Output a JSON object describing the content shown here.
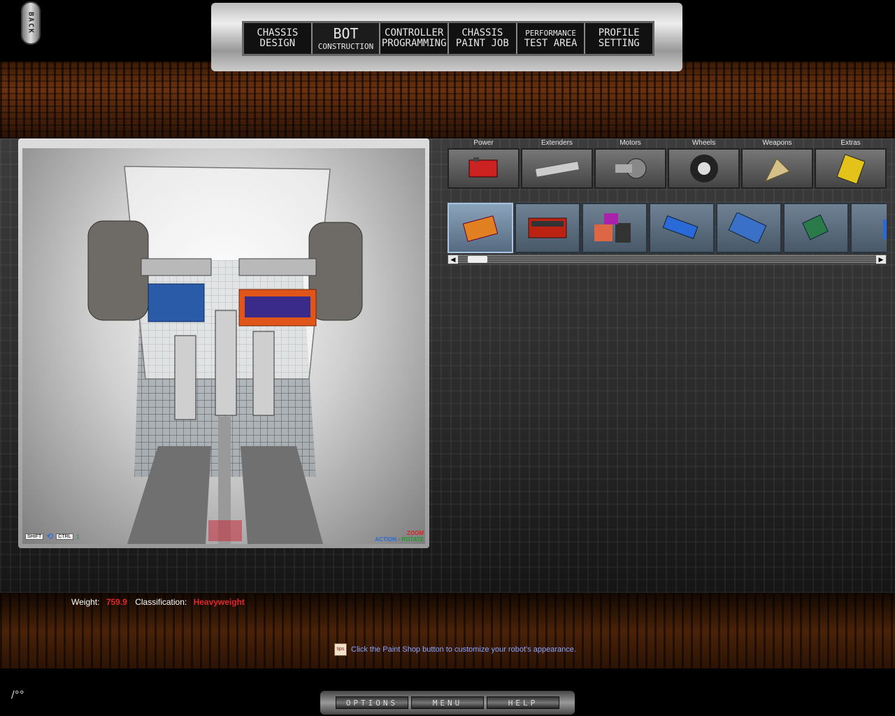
{
  "back": {
    "label": "BACK"
  },
  "top_nav": [
    {
      "line1": "CHASSIS",
      "line2": "DESIGN",
      "style": "normal"
    },
    {
      "line1": "BOT",
      "line2": "CONSTRUCTION",
      "style": "big"
    },
    {
      "line1": "CONTROLLER",
      "line2": "PROGRAMMING",
      "style": "normal"
    },
    {
      "line1": "CHASSIS",
      "line2": "PAINT JOB",
      "style": "normal"
    },
    {
      "line1": "PERFORMANCE",
      "line2": "TEST AREA",
      "style": "small"
    },
    {
      "line1": "PROFILE",
      "line2": "SETTING",
      "style": "normal"
    }
  ],
  "viewport": {
    "hint_left": {
      "key1": "SHIFT",
      "key2": "CTRL"
    },
    "hint_right": {
      "zoom": "ZOOM",
      "action": "ACTION",
      "rotate": "ROTATE"
    }
  },
  "categories": [
    {
      "label": "Power",
      "icon": "battery-icon"
    },
    {
      "label": "Extenders",
      "icon": "extender-bar-icon"
    },
    {
      "label": "Motors",
      "icon": "motor-icon"
    },
    {
      "label": "Wheels",
      "icon": "wheel-icon"
    },
    {
      "label": "Weapons",
      "icon": "weapon-blade-icon"
    },
    {
      "label": "Extras",
      "icon": "extras-icon"
    }
  ],
  "parts": [
    {
      "icon": "orange-battery-pack-icon",
      "selected": true
    },
    {
      "icon": "red-battery-icon",
      "selected": false
    },
    {
      "icon": "battery-set-icon",
      "selected": false
    },
    {
      "icon": "blue-battery-icon",
      "selected": false
    },
    {
      "icon": "blue-controller-icon",
      "selected": false
    },
    {
      "icon": "circuit-board-icon",
      "selected": false
    },
    {
      "icon": "partial-part-icon",
      "selected": false
    }
  ],
  "scrollbar": {
    "left": "◀",
    "right": "▶"
  },
  "status": {
    "weight_label": "Weight:",
    "weight_value": "759.9",
    "class_label": "Classification:",
    "class_value": "Heavyweight"
  },
  "tip": {
    "icon_text": "tips",
    "text": "Click the Paint Shop button to customize your robot's appearance."
  },
  "bottom_nav": [
    "OPTIONS",
    "MENU",
    "HELP"
  ],
  "corner": {
    "text": "/°°"
  },
  "colors": {
    "value_red": "#e4252a",
    "tip_blue": "#88a4ff",
    "selected_border": "#a9c5e2"
  }
}
